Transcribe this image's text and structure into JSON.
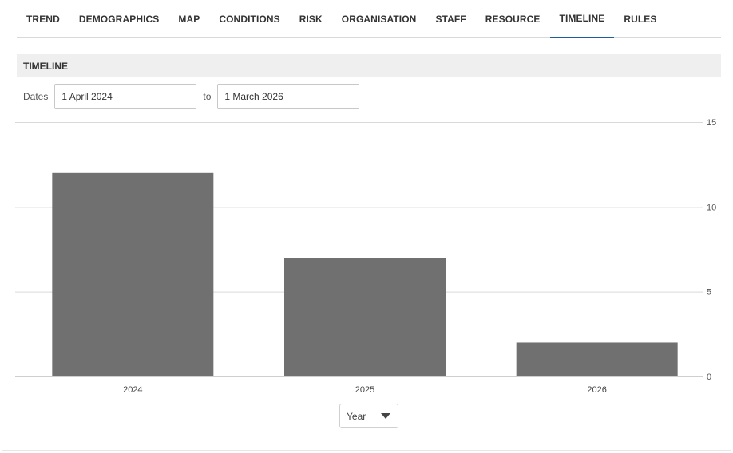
{
  "tabs": [
    {
      "label": "TREND",
      "active": false
    },
    {
      "label": "DEMOGRAPHICS",
      "active": false
    },
    {
      "label": "MAP",
      "active": false
    },
    {
      "label": "CONDITIONS",
      "active": false
    },
    {
      "label": "RISK",
      "active": false
    },
    {
      "label": "ORGANISATION",
      "active": false
    },
    {
      "label": "STAFF",
      "active": false
    },
    {
      "label": "RESOURCE",
      "active": false
    },
    {
      "label": "TIMELINE",
      "active": true
    },
    {
      "label": "RULES",
      "active": false
    }
  ],
  "section": {
    "title": "TIMELINE"
  },
  "dates": {
    "label": "Dates",
    "from_value": "1 April 2024",
    "to_label": "to",
    "to_value": "1 March 2026"
  },
  "group_select": {
    "value": "Year",
    "icon": "chevron-down-icon"
  },
  "colors": {
    "bar": "#707070",
    "grid": "#d9d9d9",
    "active_tab": "#1f5e96"
  },
  "chart_data": {
    "type": "bar",
    "categories": [
      "2024",
      "2025",
      "2026"
    ],
    "values": [
      12,
      7,
      2
    ],
    "ylim": [
      0,
      15
    ],
    "yticks": [
      "0",
      "5",
      "10",
      "15"
    ],
    "yaxis_side": "right",
    "grid": true,
    "legend": "none"
  }
}
